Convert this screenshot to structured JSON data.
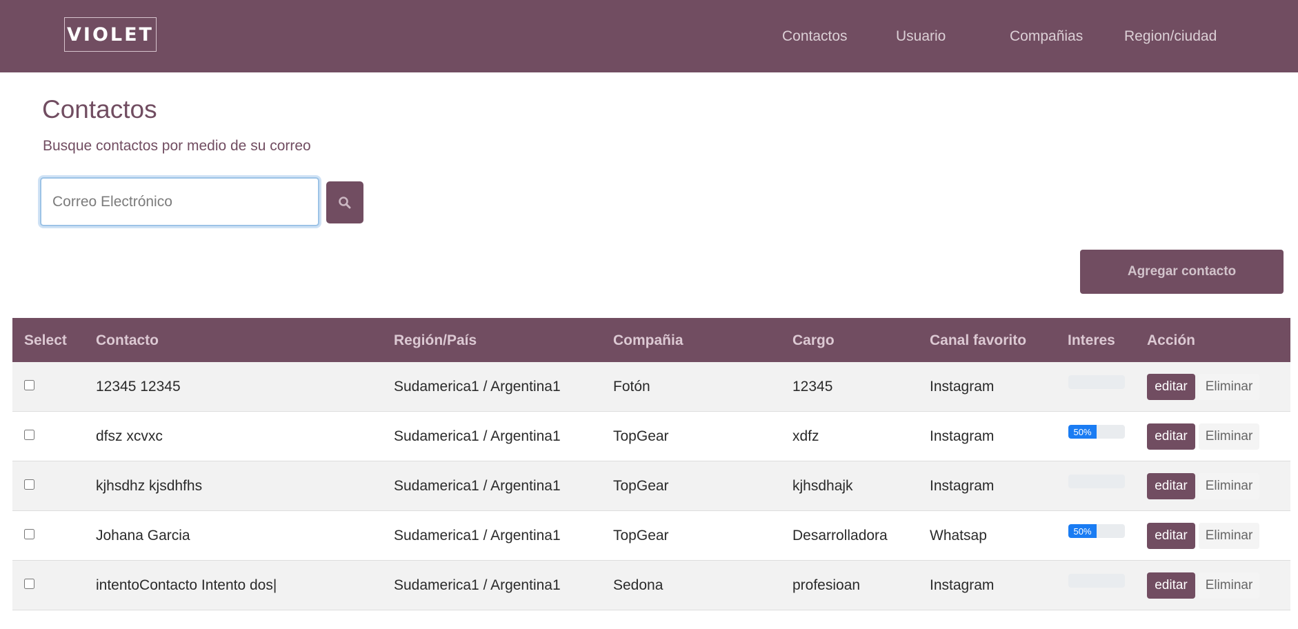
{
  "navbar": {
    "logo": "VIOLET",
    "links": [
      "Contactos",
      "Usuario",
      "Compañias",
      "Region/ciudad"
    ]
  },
  "page": {
    "title": "Contactos",
    "subtitle": "Busque contactos por medio de su correo"
  },
  "search": {
    "placeholder": "Correo Electrónico",
    "value": "",
    "button_icon": "search-icon"
  },
  "actions": {
    "add_contact_label": "Agregar contacto"
  },
  "table": {
    "columns": [
      "Select",
      "Contacto",
      "Región/País",
      "Compañia",
      "Cargo",
      "Canal favorito",
      "Interes",
      "Acción"
    ],
    "rows": [
      {
        "contacto": "12345 12345",
        "region": "Sudamerica1 / Argentina1",
        "compania": "Fotón",
        "cargo": "12345",
        "canal": "Instagram",
        "interes": 0,
        "interes_label": "",
        "edit_label": "editar",
        "delete_label": "Eliminar",
        "selected": false
      },
      {
        "contacto": "dfsz xcvxc",
        "region": "Sudamerica1 / Argentina1",
        "compania": "TopGear",
        "cargo": "xdfz",
        "canal": "Instagram",
        "interes": 50,
        "interes_label": "50%",
        "edit_label": "editar",
        "delete_label": "Eliminar",
        "selected": false
      },
      {
        "contacto": "kjhsdhz kjsdhfhs",
        "region": "Sudamerica1 / Argentina1",
        "compania": "TopGear",
        "cargo": "kjhsdhajk",
        "canal": "Instagram",
        "interes": 0,
        "interes_label": "",
        "edit_label": "editar",
        "delete_label": "Eliminar",
        "selected": false
      },
      {
        "contacto": "Johana Garcia",
        "region": "Sudamerica1 / Argentina1",
        "compania": "TopGear",
        "cargo": "Desarrolladora",
        "canal": "Whatsap",
        "interes": 50,
        "interes_label": "50%",
        "edit_label": "editar",
        "delete_label": "Eliminar",
        "selected": false
      },
      {
        "contacto": "intentoContacto Intento dos|",
        "region": "Sudamerica1 / Argentina1",
        "compania": "Sedona",
        "cargo": "profesioan",
        "canal": "Instagram",
        "interes": 0,
        "interes_label": "",
        "edit_label": "editar",
        "delete_label": "Eliminar",
        "selected": false
      }
    ]
  },
  "colors": {
    "brand": "#714d61",
    "progress": "#1a7cf3"
  }
}
